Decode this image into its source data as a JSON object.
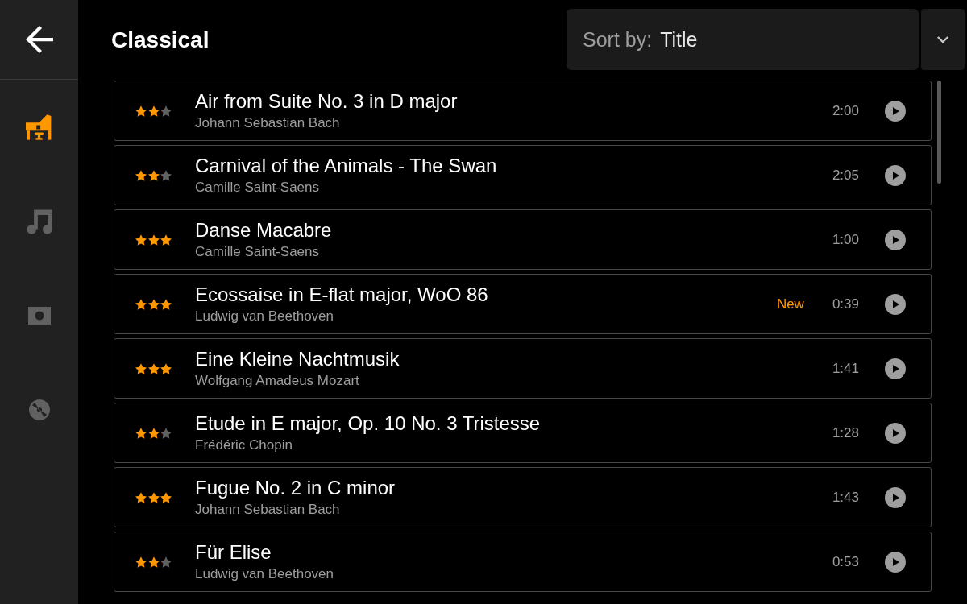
{
  "sidebar": {
    "items": [
      {
        "kind": "piano",
        "selected": true
      },
      {
        "kind": "music",
        "selected": false
      },
      {
        "kind": "photo",
        "selected": false
      },
      {
        "kind": "disc",
        "selected": false
      }
    ]
  },
  "header": {
    "title": "Classical",
    "sort": {
      "label": "Sort by:",
      "value": "Title"
    }
  },
  "tracks": [
    {
      "title": "Air from Suite No. 3 in D major",
      "artist": "Johann Sebastian Bach",
      "stars": 2,
      "duration": "2:00"
    },
    {
      "title": "Carnival of the Animals - The Swan",
      "artist": "Camille Saint-Saens",
      "stars": 2,
      "duration": "2:05"
    },
    {
      "title": "Danse Macabre",
      "artist": "Camille Saint-Saens",
      "stars": 3,
      "duration": "1:00"
    },
    {
      "title": "Ecossaise in E-flat major, WoO 86",
      "artist": "Ludwig van Beethoven",
      "stars": 3,
      "badge": "New",
      "duration": "0:39"
    },
    {
      "title": "Eine Kleine Nachtmusik",
      "artist": "Wolfgang Amadeus Mozart",
      "stars": 3,
      "duration": "1:41"
    },
    {
      "title": "Etude in E major, Op. 10 No. 3 Tristesse",
      "artist": "Frédéric Chopin",
      "stars": 2,
      "duration": "1:28"
    },
    {
      "title": "Fugue No. 2 in C minor",
      "artist": "Johann Sebastian Bach",
      "stars": 3,
      "duration": "1:43"
    },
    {
      "title": "Für Elise",
      "artist": "Ludwig van Beethoven",
      "stars": 2,
      "duration": "0:53"
    }
  ]
}
